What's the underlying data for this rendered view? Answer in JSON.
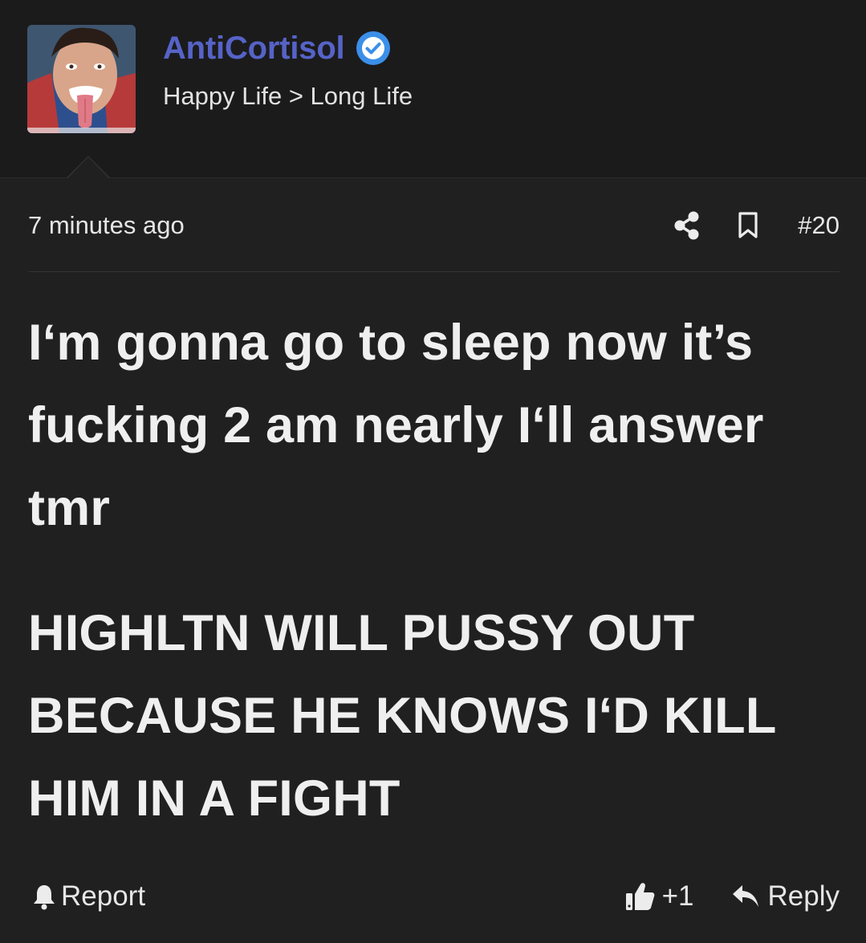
{
  "author": {
    "username": "AntiCortisol",
    "tagline": "Happy Life > Long Life",
    "verified": true,
    "avatar_icon": "user-avatar-photo"
  },
  "post": {
    "timestamp": "7 minutes ago",
    "number": "#20",
    "paragraphs": [
      "I‘m gonna go to sleep now it’s fucking 2 am nearly I‘ll answer tmr",
      "HIGHLTN WILL PUSSY OUT BECAUSE HE KNOWS I‘D KILL HIM IN A FIGHT"
    ]
  },
  "actions": {
    "share_icon": "share-icon",
    "bookmark_icon": "bookmark-icon",
    "report_label": "Report",
    "like_count": "+1",
    "reply_label": "Reply"
  },
  "colors": {
    "background": "#202021",
    "header_background": "#1b1b1c",
    "username": "#5663c7",
    "verified_badge": "#3b8fe8",
    "text": "#efefef"
  }
}
